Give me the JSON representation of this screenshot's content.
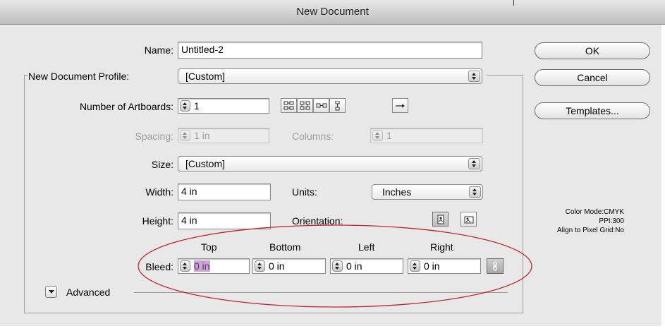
{
  "window": {
    "title": "New Document"
  },
  "form": {
    "name": {
      "label": "Name:",
      "value": "Untitled-2"
    },
    "profile": {
      "label": "New Document Profile:",
      "value": "[Custom]"
    },
    "artboards": {
      "label": "Number of Artboards:",
      "value": "1"
    },
    "spacing": {
      "label": "Spacing:",
      "value": "1 in"
    },
    "columns": {
      "label": "Columns:",
      "value": "1"
    },
    "size": {
      "label": "Size:",
      "value": "[Custom]"
    },
    "width": {
      "label": "Width:",
      "value": "4 in"
    },
    "units": {
      "label": "Units:",
      "value": "Inches"
    },
    "height": {
      "label": "Height:",
      "value": "4 in"
    },
    "orientation": {
      "label": "Orientation:"
    },
    "bleed": {
      "label": "Bleed:",
      "headers": [
        "Top",
        "Bottom",
        "Left",
        "Right"
      ],
      "values": [
        "0 in",
        "0 in",
        "0 in",
        "0 in"
      ]
    },
    "advanced": {
      "label": "Advanced"
    }
  },
  "buttons": {
    "ok": "OK",
    "cancel": "Cancel",
    "templates": "Templates..."
  },
  "info": {
    "color_mode": {
      "key": "Color Mode:",
      "value": "CMYK"
    },
    "ppi": {
      "key": "PPI:",
      "value": "300"
    },
    "align": {
      "key": "Align to Pixel Grid:",
      "value": "No"
    }
  },
  "colors": {
    "annotation_ellipse": "#c0262e",
    "selection_highlight": "#c9a6d2"
  },
  "icons": [
    "grid-by-row-icon",
    "grid-by-column-icon",
    "arrange-by-row-icon",
    "arrange-by-column-icon",
    "left-to-right-layout-icon",
    "portrait-icon",
    "landscape-icon",
    "link-bleed-icon",
    "disclosure-triangle-icon"
  ]
}
